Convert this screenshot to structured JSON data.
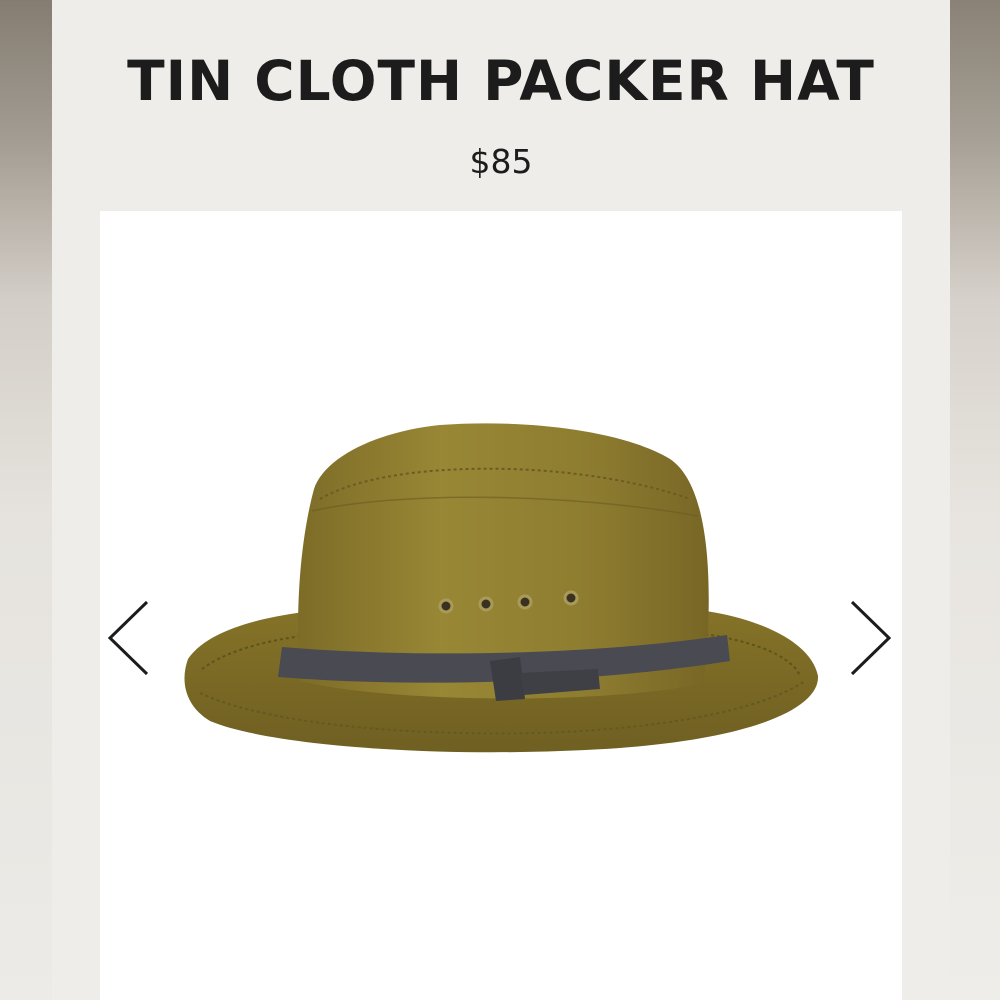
{
  "product": {
    "title": "TIN CLOTH PACKER HAT",
    "price": "$85"
  },
  "gallery": {
    "prev_icon": "chevron-left-icon",
    "next_icon": "chevron-right-icon"
  },
  "colors": {
    "page_background": "#efede9",
    "image_background": "#ffffff",
    "hat_body": "#8c7a32",
    "hat_band": "#4a4a52",
    "text": "#1c1c1c"
  }
}
